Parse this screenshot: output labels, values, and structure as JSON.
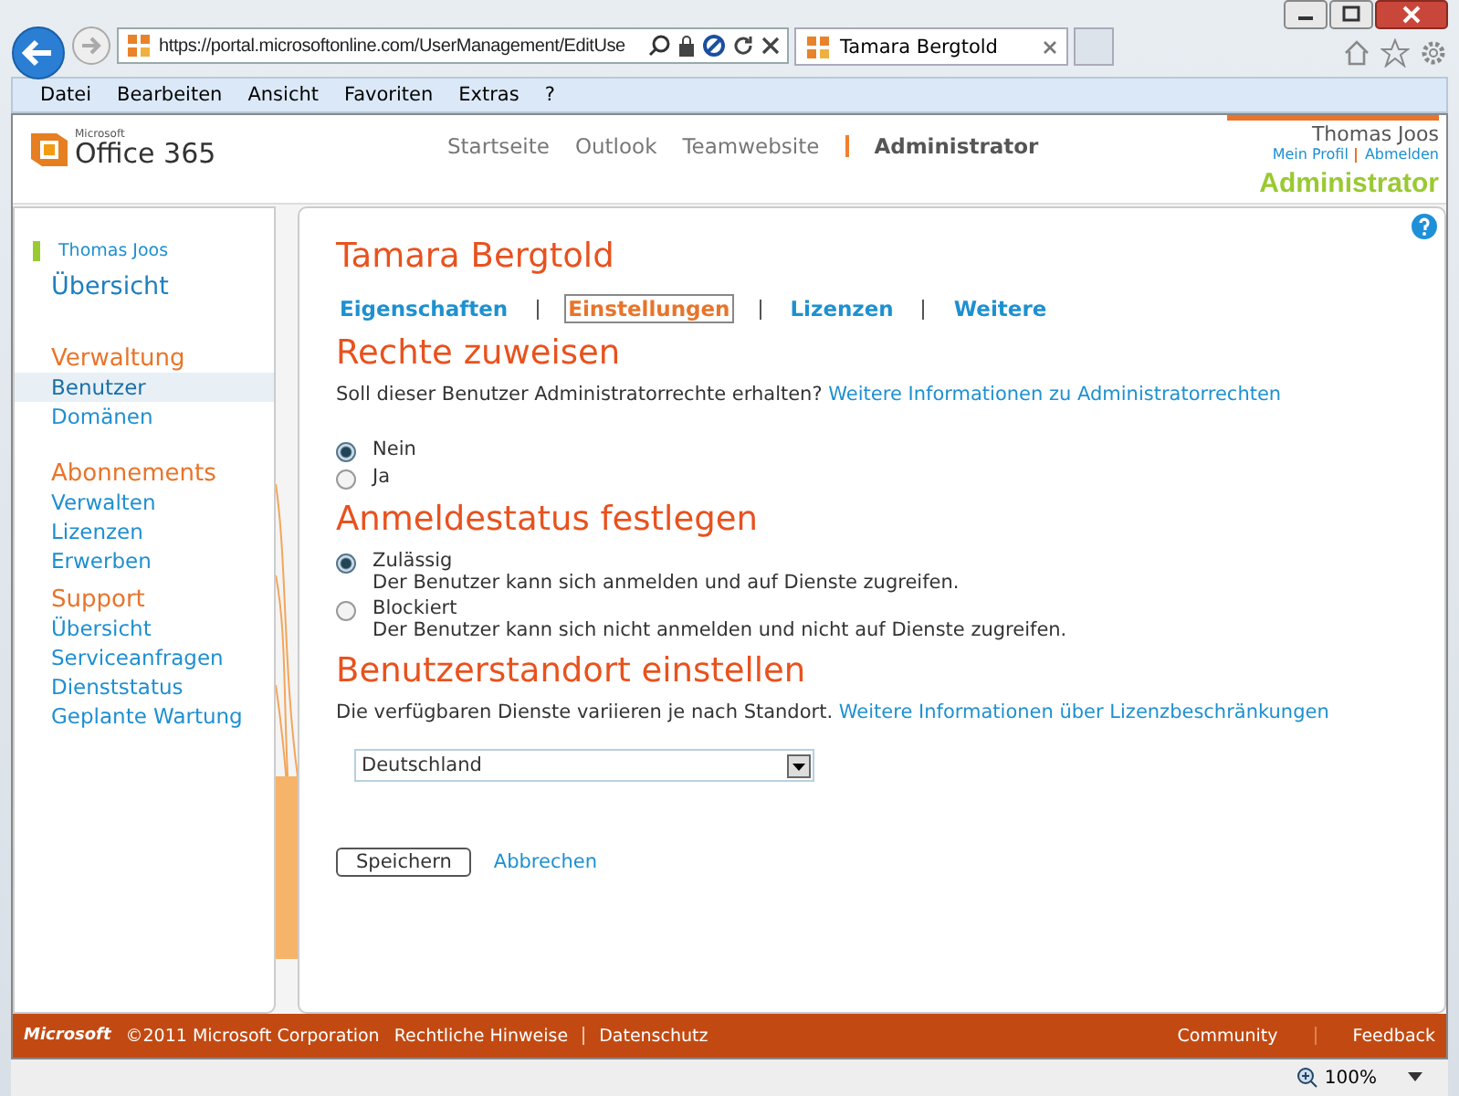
{
  "browser": {
    "address": "https://portal.microsoftonline.com/UserManagement/EditUse",
    "tab_title": "Tamara Bergtold",
    "menu": [
      "Datei",
      "Bearbeiten",
      "Ansicht",
      "Favoriten",
      "Extras",
      "?"
    ],
    "zoom": "100%"
  },
  "header": {
    "logo_small": "Microsoft",
    "logo": "Office 365",
    "nav": [
      {
        "label": "Startseite",
        "selected": false
      },
      {
        "label": "Outlook",
        "selected": false
      },
      {
        "label": "Teamwebsite",
        "selected": false
      },
      {
        "label": "Administrator",
        "selected": true
      }
    ],
    "user": "Thomas Joos",
    "links": [
      "Mein Profil",
      "Abmelden"
    ],
    "role": "Administrator"
  },
  "sidebar": {
    "user": "Thomas Joos",
    "overview": "Übersicht",
    "sections": [
      {
        "title": "Verwaltung",
        "items": [
          {
            "label": "Benutzer",
            "selected": true
          },
          {
            "label": "Domänen",
            "selected": false
          }
        ]
      },
      {
        "title": "Abonnements",
        "items": [
          {
            "label": "Verwalten",
            "selected": false
          },
          {
            "label": "Lizenzen",
            "selected": false
          },
          {
            "label": "Erwerben",
            "selected": false
          }
        ]
      },
      {
        "title": "Support",
        "items": [
          {
            "label": "Übersicht",
            "selected": false
          },
          {
            "label": "Serviceanfragen",
            "selected": false
          },
          {
            "label": "Dienststatus",
            "selected": false
          },
          {
            "label": "Geplante Wartung",
            "selected": false
          }
        ]
      }
    ]
  },
  "main": {
    "title": "Tamara Bergtold",
    "tabs": [
      {
        "label": "Eigenschaften",
        "selected": false
      },
      {
        "label": "Einstellungen",
        "selected": true
      },
      {
        "label": "Lizenzen",
        "selected": false
      },
      {
        "label": "Weitere",
        "selected": false
      }
    ],
    "sections": [
      {
        "heading": "Rechte zuweisen",
        "kind": "radios",
        "text": "Soll dieser Benutzer Administratorrechte erhalten?",
        "link": "Weitere Informationen zu Administratorrechten",
        "options": [
          {
            "label": "Nein",
            "selected": true
          },
          {
            "label": "Ja",
            "selected": false
          }
        ]
      },
      {
        "heading": "Anmeldestatus festlegen",
        "kind": "radios",
        "options": [
          {
            "label": "Zulässig",
            "description": "Der Benutzer kann sich anmelden und auf Dienste zugreifen.",
            "selected": true
          },
          {
            "label": "Blockiert",
            "description": "Der Benutzer kann sich nicht anmelden und nicht auf Dienste zugreifen.",
            "selected": false
          }
        ]
      },
      {
        "heading": "Benutzerstandort einstellen",
        "kind": "select",
        "text": "Die verfügbaren Dienste variieren je nach Standort.",
        "link": "Weitere Informationen über Lizenzbeschränkungen",
        "value": "Deutschland"
      }
    ],
    "save": "Speichern",
    "cancel": "Abbrechen"
  },
  "footer": {
    "logo": "Microsoft",
    "copyright": "©2011 Microsoft Corporation",
    "links": [
      "Rechtliche Hinweise",
      "Datenschutz"
    ],
    "right_links": [
      "Community",
      "Feedback"
    ]
  }
}
